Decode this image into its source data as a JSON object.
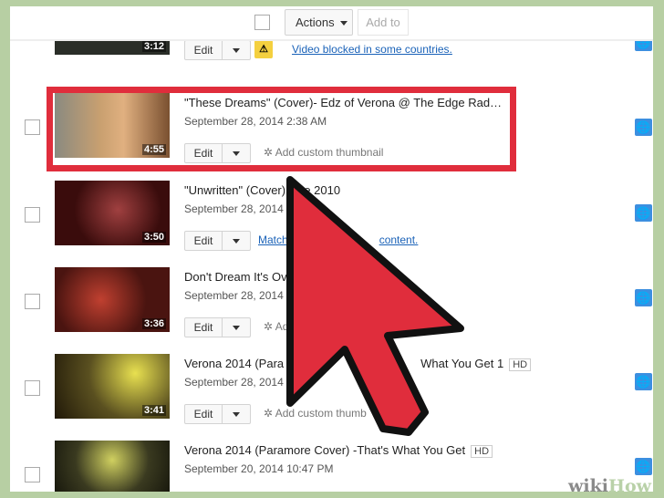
{
  "toolbar": {
    "actions_label": "Actions",
    "add_to_label": "Add to"
  },
  "videos": [
    {
      "duration": "3:12",
      "edit": "Edit",
      "notice": "Video blocked in some countries.",
      "thumb_color": "#2a2e28"
    },
    {
      "duration": "4:55",
      "title": "\"These Dreams\" (Cover)- Edz of Verona @ The Edge Rad…",
      "date": "September 28, 2014 2:38 AM",
      "edit": "Edit",
      "extra": "Add custom thumbnail",
      "thumb_color": "#c9a070"
    },
    {
      "duration": "3:50",
      "title": "\"Unwritten\" (Cover) Live 2010",
      "date": "September 28, 2014 2",
      "edit": "Edit",
      "extra": "Match",
      "extra2": "content.",
      "thumb_color": "#3a0c0c"
    },
    {
      "duration": "3:36",
      "title": "Don't Dream It's Ov",
      "date": "September 28, 2014 2",
      "edit": "Edit",
      "extra": "Ad",
      "thumb_color": "#4a1410"
    },
    {
      "duration": "3:41",
      "title": "Verona 2014 (Para",
      "title_end": "What You Get 1",
      "badge": "HD",
      "date": "September 28, 2014 1",
      "edit": "Edit",
      "extra": "Add custom thumb",
      "thumb_color": "#5a5020"
    },
    {
      "title": "Verona 2014 (Paramore Cover) -That's What You Get",
      "badge": "HD",
      "date": "September 20, 2014 10:47 PM",
      "thumb_color": "#3a3a20"
    }
  ],
  "colors": {
    "frame": "#b7cfa3",
    "highlight": "#e02d3c",
    "globe": "#3c8fe0"
  },
  "watermark": {
    "a": "wiki",
    "b": "How"
  }
}
